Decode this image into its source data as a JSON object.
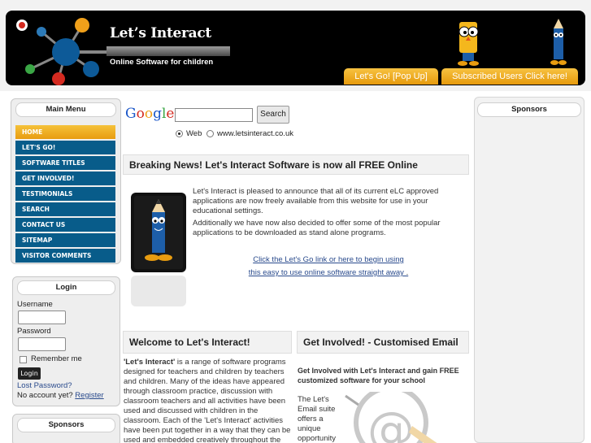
{
  "header": {
    "title": "Let’s Interact",
    "subtitle": "Online Software for children",
    "buttons": {
      "lets_go": "Let's Go! [Pop Up]",
      "subscribed": "Subscribed Users Click here!"
    }
  },
  "main_menu": {
    "title": "Main Menu",
    "items": [
      {
        "label": "HOME",
        "active": true
      },
      {
        "label": "LET'S GO!"
      },
      {
        "label": "SOFTWARE TITLES"
      },
      {
        "label": "GET INVOLVED!"
      },
      {
        "label": "TESTIMONIALS"
      },
      {
        "label": "SEARCH"
      },
      {
        "label": "CONTACT US"
      },
      {
        "label": "SITEMAP"
      },
      {
        "label": "VISITOR COMMENTS"
      }
    ]
  },
  "login": {
    "title": "Login",
    "username_label": "Username",
    "password_label": "Password",
    "remember_label": "Remember me",
    "login_button": "Login",
    "lost_password": "Lost Password?",
    "no_account": "No account yet?",
    "register": "Register"
  },
  "sponsors_left": {
    "title": "Sponsors"
  },
  "sponsors_right": {
    "title": "Sponsors"
  },
  "google_search": {
    "button": "Search",
    "option_web": "Web",
    "option_site": "www.letsinteract.co.uk"
  },
  "news": {
    "title": "Breaking News! Let's Interact Software is now all FREE Online",
    "p1": "Let's Interact is pleased to announce that all of its current eLC approved applications are now freely available from this website for use in your educational settings.",
    "p2": "Additionally we have now also decided to offer some of the most popular applications to be downloaded as stand alone programs.",
    "link1": "Click the Let's Go link or here to begin using",
    "link2": "this easy to use online software straight away",
    "link2_suffix": " ."
  },
  "welcome": {
    "title": "Welcome to Let's Interact!",
    "bold_lead": "'Let's Interact'",
    "text": " is a range of software programs designed for teachers and children by teachers and children. Many of the ideas have appeared through classroom practice, discussion with classroom teachers and all activities have been used and discussed with children in the classroom. Each of the 'Let's Interact' activities have been put together in a way that they can be used and embedded creatively throughout the whole"
  },
  "get_involved": {
    "title": "Get Involved! - Customised Email",
    "bold": "Get Involved with Let's Interact and gain FREE customized software for your school",
    "text": "The Let's Email suite offers a unique opportunity"
  },
  "colors": {
    "menu_blue": "#085c8a",
    "accent_orange": "#e89c10",
    "link": "#2a4b8d"
  }
}
